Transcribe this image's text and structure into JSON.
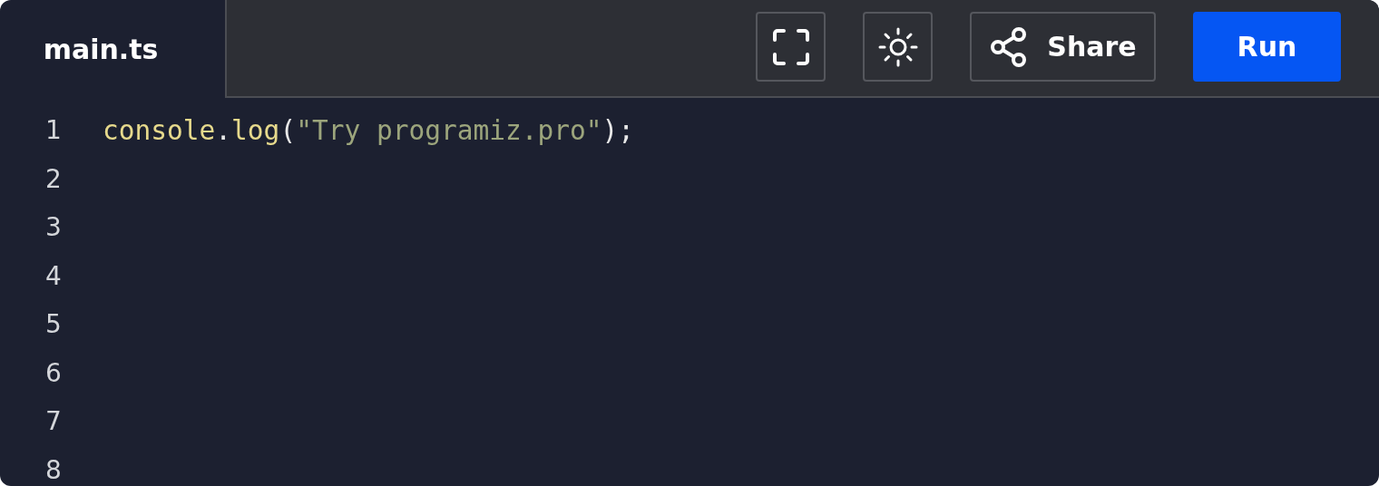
{
  "tabs": [
    {
      "label": "main.ts",
      "selected": true
    }
  ],
  "toolbar": [
    {
      "kind": "fullscreen"
    },
    {
      "kind": "theme"
    },
    {
      "kind": "share",
      "label": "Share"
    },
    {
      "kind": "run",
      "label": "Run"
    }
  ],
  "editor": {
    "lines": [
      {
        "number": "1",
        "tokens": [
          {
            "kind": "function",
            "text": "console"
          },
          {
            "kind": "punct",
            "text": "."
          },
          {
            "kind": "function",
            "text": "log"
          },
          {
            "kind": "punct",
            "text": "("
          },
          {
            "kind": "string",
            "text": "\"Try programiz.pro\""
          },
          {
            "kind": "punct",
            "text": ");"
          }
        ]
      },
      {
        "number": "2"
      },
      {
        "number": "3"
      },
      {
        "number": "4"
      },
      {
        "number": "5"
      },
      {
        "number": "6"
      },
      {
        "number": "7"
      },
      {
        "number": "8"
      }
    ]
  }
}
